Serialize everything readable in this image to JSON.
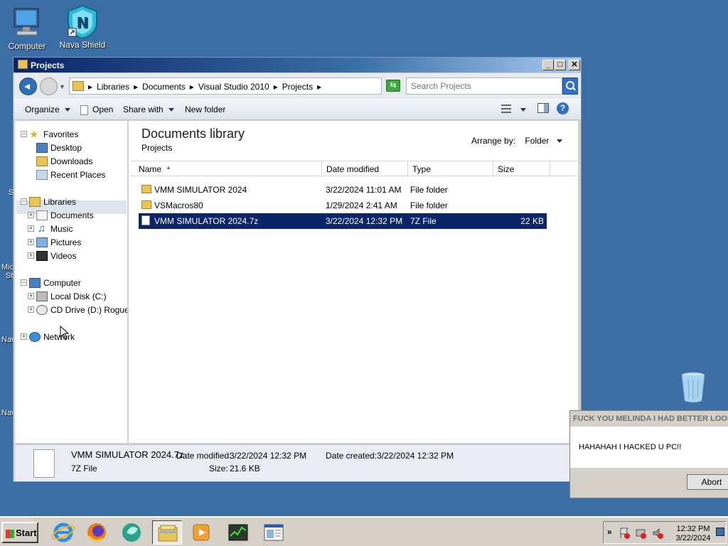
{
  "desktop": {
    "icons": [
      {
        "label": "Computer"
      },
      {
        "label": "Nava Shield"
      }
    ],
    "edge_labels": [
      "S",
      "Mic",
      "St",
      "Nav",
      "Nav"
    ]
  },
  "window": {
    "title": "Projects",
    "controls": {
      "minimize": "_",
      "maximize": "□",
      "close": "✕"
    },
    "breadcrumbs": [
      "Libraries",
      "Documents",
      "Visual Studio 2010",
      "Projects"
    ],
    "search_placeholder": "Search Projects",
    "toolbar": {
      "organize": "Organize",
      "open": "Open",
      "share_with": "Share with",
      "new_folder": "New folder",
      "help": "?"
    },
    "nav": {
      "favorites": "Favorites",
      "favorites_items": [
        "Desktop",
        "Downloads",
        "Recent Places"
      ],
      "libraries": "Libraries",
      "libraries_items": [
        "Documents",
        "Music",
        "Pictures",
        "Videos"
      ],
      "computer": "Computer",
      "computer_items": [
        "Local Disk (C:)",
        "CD Drive (D:) Rogue P"
      ],
      "network": "Network"
    },
    "content": {
      "title": "Documents library",
      "subtitle": "Projects",
      "arrange_label": "Arrange by:",
      "arrange_value": "Folder",
      "columns": [
        "Name",
        "Date modified",
        "Type",
        "Size"
      ],
      "rows": [
        {
          "name": "VMM SIMULATOR 2024",
          "date": "3/22/2024 11:01 AM",
          "type": "File folder",
          "size": ""
        },
        {
          "name": "VSMacros80",
          "date": "1/29/2024 2:41 AM",
          "type": "File folder",
          "size": ""
        },
        {
          "name": "VMM SIMULATOR 2024.7z",
          "date": "3/22/2024 12:32 PM",
          "type": "7Z File",
          "size": "22 KB"
        }
      ],
      "selected_index": 2
    },
    "details": {
      "name": "VMM SIMULATOR 2024.7z",
      "type": "7Z File",
      "date_modified_label": "Date modified:",
      "date_modified": "3/22/2024 12:32 PM",
      "date_created_label": "Date created:",
      "date_created": "3/22/2024 12:32 PM",
      "size_label": "Size:",
      "size": "21.6 KB"
    }
  },
  "popup": {
    "title": "FUCK YOU MELINDA I HAD BETTER LOOK",
    "message": "HAHAHAH I HACKED U PC!!",
    "button": "Abort"
  },
  "taskbar": {
    "start": "Start",
    "tray_arrow": "»",
    "time": "12:32 PM",
    "date": "3/22/2024"
  },
  "colors": {
    "desktop": "#3a6ea5",
    "selection": "#0a246a",
    "accent": "#2f6fc4"
  }
}
